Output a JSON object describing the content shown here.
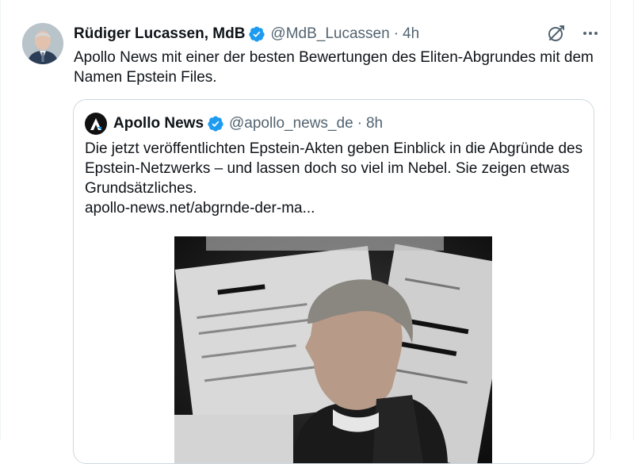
{
  "tweet": {
    "author_name": "Rüdiger Lucassen, MdB",
    "handle": "@MdB_Lucassen",
    "separator": "·",
    "time": "4h",
    "text": "Apollo News mit einer der besten Bewertungen des Eliten-Abgrundes mit dem Namen Epstein Files."
  },
  "quote": {
    "author_name": "Apollo News",
    "handle": "@apollo_news_de",
    "separator": "·",
    "time": "8h",
    "text": "Die jetzt veröffentlichten Epstein-Akten geben Einblick in die Abgründe des Epstein-Netzwerks – und lassen doch so viel im Nebel. Sie zeigen etwas Grundsätzliches.",
    "link": "apollo-news.net/abgrnde-der-ma..."
  },
  "icons": {
    "verified": "verified-badge-icon",
    "grok": "grok-icon",
    "more": "more-icon",
    "logo": "apollo-logo-icon"
  },
  "colors": {
    "verified": "#1d9bf0",
    "secondary_text": "#536471",
    "border": "#cfd9de"
  }
}
